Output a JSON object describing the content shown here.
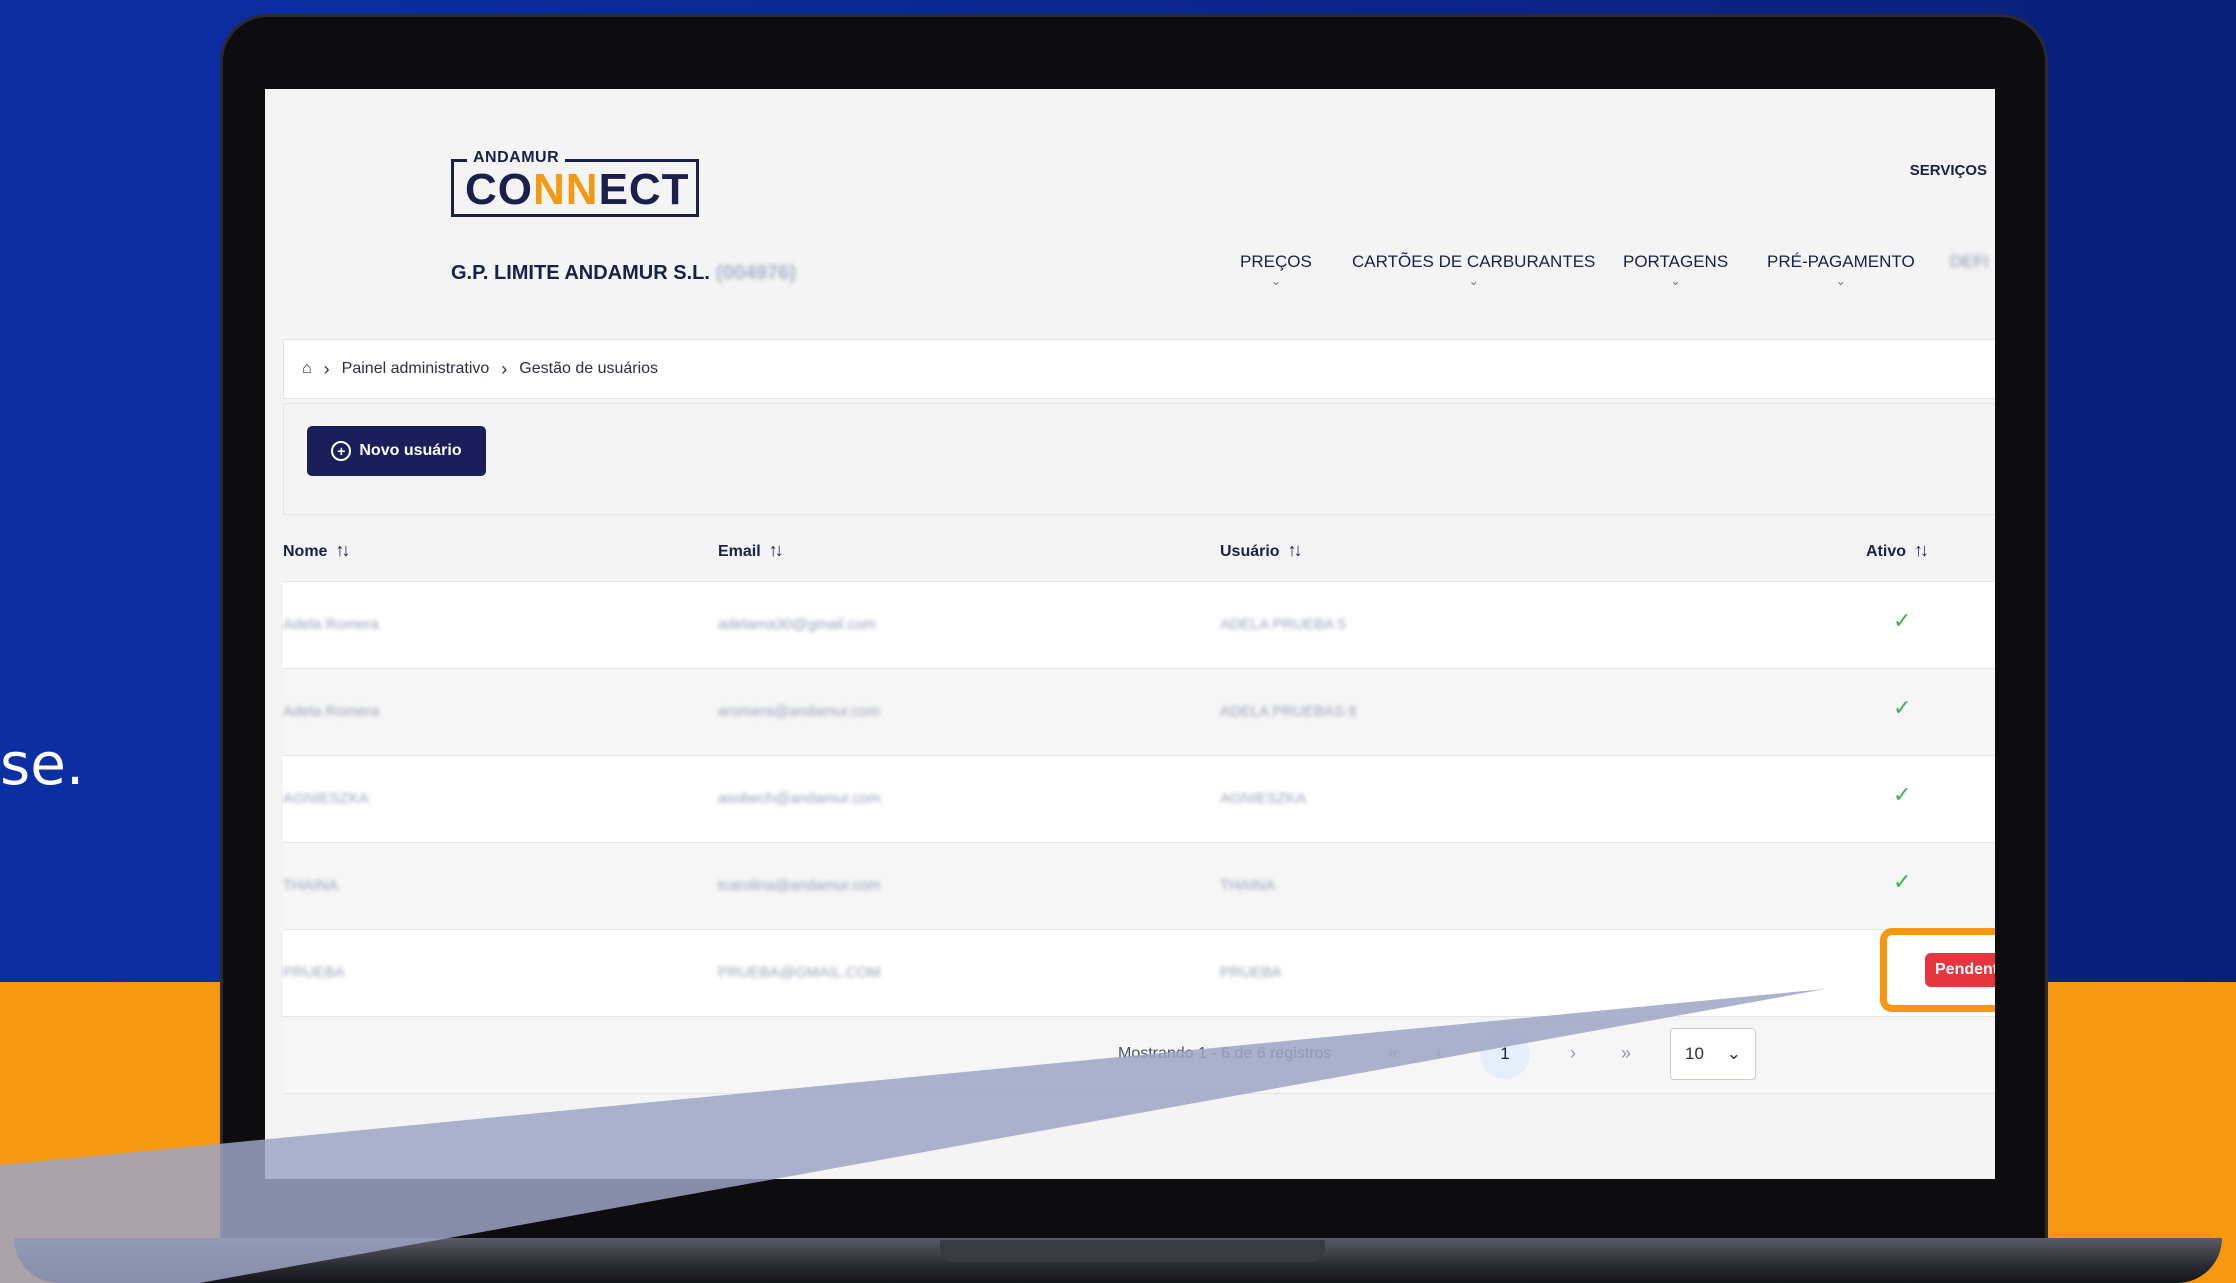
{
  "side_text": "se.",
  "logo": {
    "top": "ANDAMUR",
    "word_a": "CO",
    "word_b": "NN",
    "word_c": "ECT"
  },
  "company": {
    "name": "G.P. LIMITE ANDAMUR S.L.",
    "id": "(004976)"
  },
  "nav": {
    "top_item": "SERVIÇOS",
    "items": [
      "PREÇOS",
      "CARTÕES DE CARBURANTES",
      "PORTAGENS",
      "PRÉ-PAGAMENTO"
    ],
    "truncated": "DEFI",
    "chevron": "⌄"
  },
  "breadcrumb": {
    "home_icon": "⌂",
    "sep": "›",
    "level1": "Painel administrativo",
    "level2": "Gestão de usuários"
  },
  "new_user_button": "Novo usuário",
  "table": {
    "headers": {
      "nome": "Nome",
      "email": "Email",
      "usuario": "Usuário",
      "ativo": "Ativo"
    },
    "sort_icon": "↑↓",
    "rows": [
      {
        "nome": "Adela Romera",
        "email": "adelama30@gmail.com",
        "usuario": "ADELA PRUEBA 5",
        "ativo": "✓"
      },
      {
        "nome": "Adela Romera",
        "email": "aromera@andamur.com",
        "usuario": "ADELA PRUEBAS 6",
        "ativo": "✓"
      },
      {
        "nome": "AGNIESZKA",
        "email": "asobech@andamur.com",
        "usuario": "AGNIESZKA",
        "ativo": "✓"
      },
      {
        "nome": "THAINA",
        "email": "tcarolina@andamur.com",
        "usuario": "THAINA",
        "ativo": "✓"
      },
      {
        "nome": "PRUEBA",
        "email": "PRUEBA@GMAIL.COM",
        "usuario": "PRUEBA",
        "ativo": "Pendente"
      }
    ]
  },
  "pagination": {
    "summary": "Mostrando 1 - 6 de 6 registros",
    "first": "«",
    "prev": "‹",
    "current": "1",
    "next": "›",
    "last": "»",
    "per_page": "10",
    "per_page_chevron": "⌄"
  },
  "colors": {
    "brand_navy": "#1a1f5b",
    "accent_orange": "#f5970f",
    "pending_red": "#e5363f",
    "active_green": "#3bb54a"
  }
}
